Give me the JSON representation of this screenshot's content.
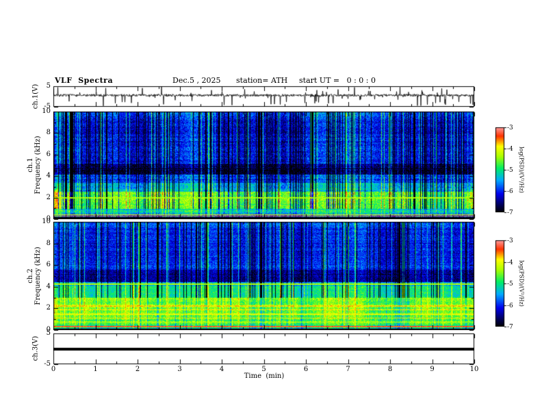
{
  "header": {
    "title": "VLF  Spectra",
    "date": "Dec.5 , 2025",
    "station": "station= ATH",
    "start_ut": "start UT =   0 : 0 : 0"
  },
  "time_axis": {
    "label": "Time  (min)",
    "min": 0,
    "max": 10,
    "ticks": [
      0,
      1,
      2,
      3,
      4,
      5,
      6,
      7,
      8,
      9,
      10
    ]
  },
  "colorbar": {
    "label": "log(PSD)/(V²/Hz)",
    "clim": [
      -7,
      -3
    ],
    "ticks": [
      -3,
      -4,
      -5,
      -6,
      -7
    ],
    "stops": [
      {
        "t": 0.0,
        "color": "#000000"
      },
      {
        "t": 0.08,
        "color": "#00004d"
      },
      {
        "t": 0.22,
        "color": "#0000ee"
      },
      {
        "t": 0.38,
        "color": "#00aaff"
      },
      {
        "t": 0.52,
        "color": "#00ee66"
      },
      {
        "t": 0.66,
        "color": "#aaff00"
      },
      {
        "t": 0.78,
        "color": "#ffff00"
      },
      {
        "t": 0.9,
        "color": "#ff3300"
      },
      {
        "t": 1.0,
        "color": "#ff9999"
      }
    ]
  },
  "chart_data": [
    {
      "type": "line",
      "name": "ch1 waveform",
      "ylabel": "ch.1(V)",
      "ylim": [
        -5,
        5
      ],
      "yticks": [
        5,
        -5
      ],
      "xlim": [
        0,
        10
      ],
      "baseline": 0.6,
      "noise_amplitude": 0.55,
      "spike_down_probability": 0.055,
      "spike_up_probability": 0.03,
      "spike_amplitude": 5
    },
    {
      "type": "heatmap",
      "name": "ch1 spectrogram",
      "ylabel_lines": [
        "ch.1",
        "Frequency  (kHz)"
      ],
      "ylim": [
        0,
        10
      ],
      "yticks": [
        0,
        2,
        4,
        6,
        8,
        10
      ],
      "yticks_minor": [
        1,
        3,
        5,
        7,
        9
      ],
      "xlim": [
        0,
        10
      ],
      "clim": [
        -7,
        -3
      ],
      "noise": 0.8,
      "bands": [
        {
          "f0": 0.0,
          "f1": 0.15,
          "v": -7.0
        },
        {
          "f0": 0.15,
          "f1": 0.55,
          "v": -5.6
        },
        {
          "f0": 0.55,
          "f1": 1.0,
          "v": -5.1
        },
        {
          "f0": 1.0,
          "f1": 2.6,
          "v": -4.7
        },
        {
          "f0": 2.6,
          "f1": 3.4,
          "v": -5.4
        },
        {
          "f0": 3.4,
          "f1": 4.2,
          "v": -5.9
        },
        {
          "f0": 4.2,
          "f1": 5.2,
          "v": -6.7
        },
        {
          "f0": 5.2,
          "f1": 9.6,
          "v": -6.1
        },
        {
          "f0": 9.6,
          "f1": 10.01,
          "v": -5.7
        }
      ],
      "lines": [
        {
          "f": 0.45,
          "w": 0.05,
          "v": -4.0
        },
        {
          "f": 0.3,
          "w": 0.04,
          "v": -3.5
        },
        {
          "f": 0.2,
          "w": 0.03,
          "v": -6.9
        },
        {
          "f": 2.0,
          "w": 0.06,
          "v": -4.3
        },
        {
          "f": 4.7,
          "w": 0.05,
          "v": -6.9
        }
      ],
      "blob": {
        "f0": 1.0,
        "f1": 2.8,
        "amplitude": 0.5
      },
      "streaks": {
        "dark_probability": 0.2,
        "bright_probability": 0.1,
        "min_f": 1.0
      }
    },
    {
      "type": "heatmap",
      "name": "ch2 spectrogram",
      "ylabel_lines": [
        "ch.2",
        "Frequency  (kHz)"
      ],
      "ylim": [
        0,
        10
      ],
      "yticks": [
        0,
        2,
        4,
        6,
        8,
        10
      ],
      "yticks_minor": [
        1,
        3,
        5,
        7,
        9
      ],
      "xlim": [
        0,
        10
      ],
      "clim": [
        -7,
        -3
      ],
      "noise": 0.7,
      "bands": [
        {
          "f0": 0.0,
          "f1": 0.15,
          "v": -7.0
        },
        {
          "f0": 0.15,
          "f1": 0.45,
          "v": -5.2
        },
        {
          "f0": 0.45,
          "f1": 0.95,
          "v": -4.6
        },
        {
          "f0": 0.95,
          "f1": 3.0,
          "v": -4.4
        },
        {
          "f0": 3.0,
          "f1": 4.1,
          "v": -5.0
        },
        {
          "f0": 4.1,
          "f1": 4.45,
          "v": -5.3
        },
        {
          "f0": 4.45,
          "f1": 5.6,
          "v": -6.4
        },
        {
          "f0": 5.6,
          "f1": 9.6,
          "v": -6.0
        },
        {
          "f0": 9.6,
          "f1": 10.01,
          "v": -5.8
        }
      ],
      "lines": [
        {
          "f": 4.25,
          "w": 0.06,
          "v": -4.3
        },
        {
          "f": 2.25,
          "w": 0.05,
          "v": -3.8
        },
        {
          "f": 1.9,
          "w": 0.05,
          "v": -3.9
        },
        {
          "f": 1.5,
          "w": 0.05,
          "v": -4.0
        },
        {
          "f": 1.15,
          "w": 0.04,
          "v": -3.9
        },
        {
          "f": 0.75,
          "w": 0.04,
          "v": -4.1
        },
        {
          "f": 0.35,
          "w": 0.04,
          "v": -3.4
        },
        {
          "f": 0.22,
          "w": 0.03,
          "v": -6.9
        }
      ],
      "blob": {
        "f0": 0.95,
        "f1": 3.0,
        "amplitude": 0.35
      },
      "streaks": {
        "dark_probability": 0.15,
        "bright_probability": 0.1,
        "min_f": 3.0
      }
    },
    {
      "type": "line",
      "name": "ch3 waveform",
      "ylabel": "ch.3(V)",
      "ylim": [
        -5,
        5
      ],
      "yticks": [
        5,
        -5
      ],
      "xlim": [
        0,
        10
      ],
      "constant_value": 0,
      "line_thickness_px": 4
    }
  ]
}
